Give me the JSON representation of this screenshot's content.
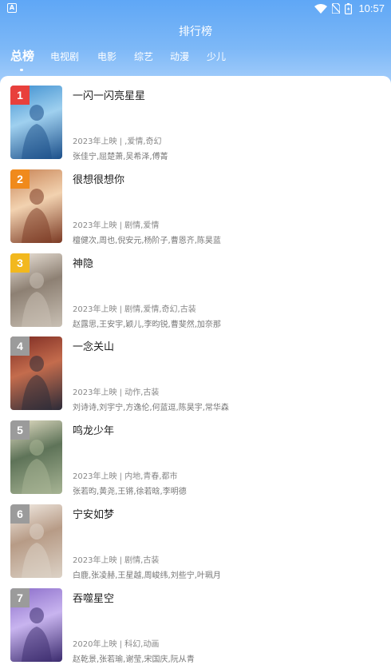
{
  "statusbar": {
    "time": "10:57"
  },
  "header": {
    "title": "排行榜"
  },
  "tabs": [
    {
      "label": "总榜",
      "active": true
    },
    {
      "label": "电视剧"
    },
    {
      "label": "电影"
    },
    {
      "label": "综艺"
    },
    {
      "label": "动漫"
    },
    {
      "label": "少儿"
    }
  ],
  "items": [
    {
      "rank": "1",
      "title": "一闪一闪亮星星",
      "meta": "2023年上映 | ,爱情,奇幻",
      "cast": "张佳宁,屈楚萧,吴希泽,傅菁",
      "rank_color": "#e8403c",
      "poster_colors": [
        "#1b4f8a",
        "#3e8fd0",
        "#9fd0ef"
      ]
    },
    {
      "rank": "2",
      "title": "很想很想你",
      "meta": "2023年上映 | 剧情,爱情",
      "cast": "檀健次,周也,倪安元,杨阶子,曹恩齐,陈昊蓝",
      "rank_color": "#f08a1c",
      "poster_colors": [
        "#7b3a24",
        "#c88456",
        "#f2d2b0"
      ]
    },
    {
      "rank": "3",
      "title": "神隐",
      "meta": "2023年上映 | 剧情,爱情,奇幻,古装",
      "cast": "赵露思,王安宇,颖儿,李昀锐,曹斐然,加奈那",
      "rank_color": "#f2b81e",
      "poster_colors": [
        "#c9c0b4",
        "#eee6dc",
        "#8d8073"
      ]
    },
    {
      "rank": "4",
      "title": "一念关山",
      "meta": "2023年上映 | 动作,古装",
      "cast": "刘诗诗,刘宇宁,方逸伦,何蓝逗,陈昊宇,常华森",
      "rank_color": "#9b9b9b",
      "poster_colors": [
        "#2c2b38",
        "#7b2a22",
        "#c46c4d"
      ]
    },
    {
      "rank": "5",
      "title": "鸣龙少年",
      "meta": "2023年上映 | 内地,青春,都市",
      "cast": "张若昀,黄尧,王锵,徐若晗,李明德",
      "rank_color": "#9b9b9b",
      "poster_colors": [
        "#a7b494",
        "#e5dfc6",
        "#5e7358"
      ]
    },
    {
      "rank": "6",
      "title": "宁安如梦",
      "meta": "2023年上映 | 剧情,古装",
      "cast": "白鹿,张凌赫,王星越,周峻纬,刘些宁,叶珮月",
      "rank_color": "#9b9b9b",
      "poster_colors": [
        "#dcd2c6",
        "#f3ede6",
        "#b79b86"
      ]
    },
    {
      "rank": "7",
      "title": "吞噬星空",
      "meta": "2020年上映 | 科幻,动画",
      "cast": "赵乾景,张若瑜,谢莹,宋国庆,阮从青",
      "rank_color": "#9b9b9b",
      "poster_colors": [
        "#3b2b6e",
        "#8a6cc9",
        "#c8b4ef"
      ]
    }
  ]
}
